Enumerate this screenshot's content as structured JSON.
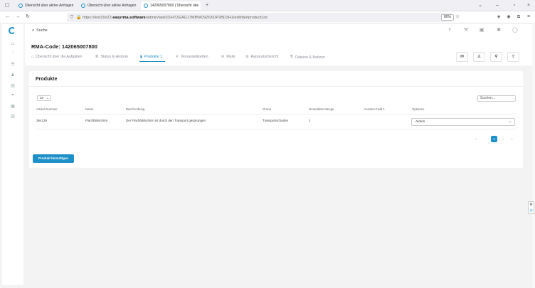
{
  "browser": {
    "tabs": [
      {
        "title": "Übersicht über aktive Anfragen",
        "active": false
      },
      {
        "title": "Übersicht über aktive Anfragen",
        "active": false
      },
      {
        "title": "142065007800 | Übersicht übe",
        "active": true
      }
    ],
    "new_tab": "+",
    "url_prefix": "https://test16n23.",
    "url_domain": "easyrma.software",
    "url_suffix": "/admin/task/01HTZEAG17MBWD9Z6XDP2BD3H1/edit/de#productList",
    "zoom": "80%"
  },
  "app": {
    "search_placeholder": "Suche",
    "rma_title": "RMA-Code: 142065007800",
    "tabs": [
      {
        "label": "Übersicht über die Aufgaben",
        "icon": "home-icon",
        "active": false
      },
      {
        "label": "Status & Historie",
        "icon": "list-icon",
        "active": false
      },
      {
        "label": "Produkte 1",
        "icon": "bookmark-icon",
        "active": true
      },
      {
        "label": "Versandetiketten",
        "icon": "pin-icon",
        "active": false
      },
      {
        "label": "Mails",
        "icon": "mail-icon",
        "active": false
      },
      {
        "label": "Reparaturbericht",
        "icon": "wrench-icon",
        "active": false
      },
      {
        "label": "Dateien & Notizen",
        "icon": "attach-icon",
        "active": false
      }
    ]
  },
  "products": {
    "card_title": "Produkte",
    "page_size": "10",
    "search_placeholder": "Suchen...",
    "columns": [
      "Artikel-Nummer",
      "Name",
      "Beschreibung",
      "Grund",
      "Gemeldete Menge",
      "Custom Field 1",
      "Optionen"
    ],
    "rows": [
      {
        "article": "364129",
        "name": "Flachbildschirm",
        "description": "Der Flachbildschirm ist durch den Transport gesprungen",
        "reason": "Transportschaden",
        "qty": "1",
        "custom": "",
        "action": "Aktion"
      }
    ],
    "pagination": {
      "first": "«",
      "prev": "‹",
      "current": "1",
      "next": "›",
      "last": "»"
    },
    "add_button": "Produkt hinzufügen"
  },
  "colors": {
    "accent": "#1e90c8"
  }
}
